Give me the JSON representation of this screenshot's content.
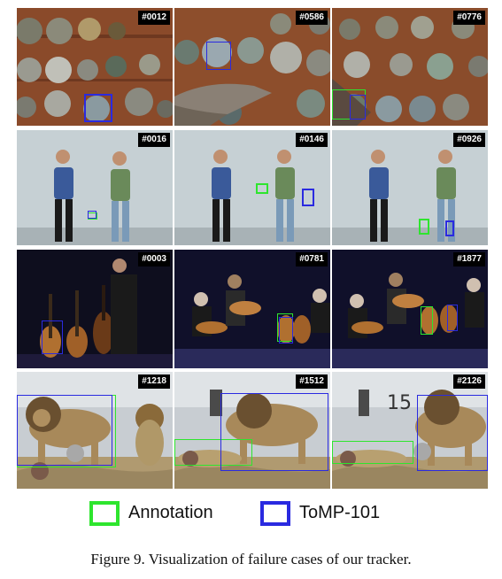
{
  "figure": {
    "caption": "Figure 9. Visualization of failure cases of our tracker.",
    "legend": [
      {
        "label": "Annotation",
        "color": "#2ee52e"
      },
      {
        "label": "ToMP-101",
        "color": "#2a2ae0"
      }
    ],
    "rows": [
      {
        "scene": "coins",
        "frames": [
          "#0012",
          "#0586",
          "#0776"
        ]
      },
      {
        "scene": "dancers",
        "frames": [
          "#0016",
          "#0146",
          "#0926"
        ]
      },
      {
        "scene": "guitars",
        "frames": [
          "#0003",
          "#0781",
          "#1877"
        ]
      },
      {
        "scene": "lions",
        "frames": [
          "#1218",
          "#1512",
          "#2126"
        ]
      }
    ]
  }
}
